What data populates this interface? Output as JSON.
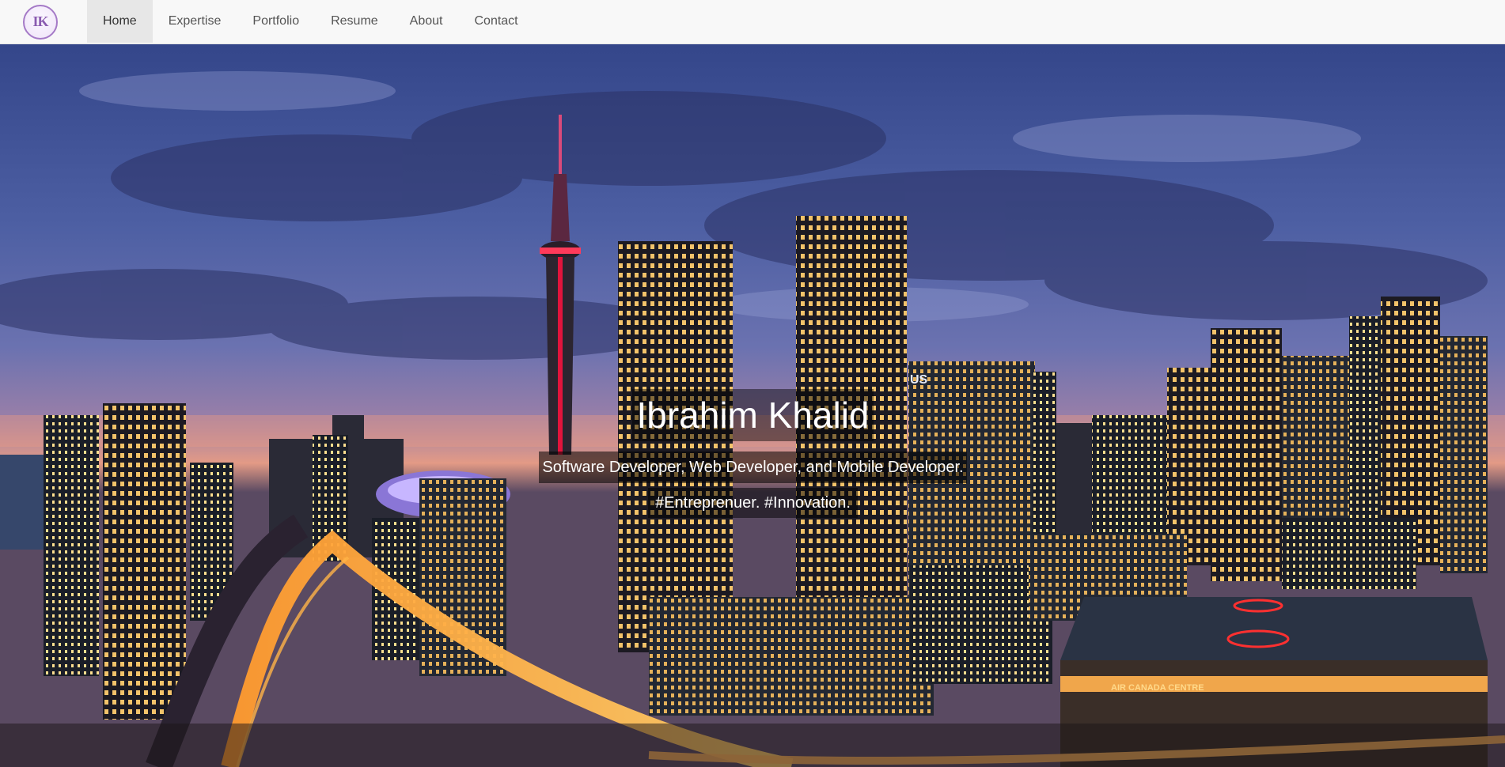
{
  "navbar": {
    "logo_text": "IK",
    "items": [
      {
        "label": "Home",
        "active": true
      },
      {
        "label": "Expertise",
        "active": false
      },
      {
        "label": "Portfolio",
        "active": false
      },
      {
        "label": "Resume",
        "active": false
      },
      {
        "label": "About",
        "active": false
      },
      {
        "label": "Contact",
        "active": false
      }
    ]
  },
  "hero": {
    "title": "Ibrahim Khalid",
    "subtitle": "Software Developer, Web Developer, and Mobile Developer.",
    "tagline": "#Entreprenuer. #Innovation.",
    "background_image": "Toronto city skyline at dusk",
    "arena_sign": "AIR CANADA CENTRE",
    "tower_sign": "US"
  },
  "colors": {
    "nav_bg": "#f8f8f8",
    "nav_active_bg": "#e7e7e7",
    "logo_accent": "#a57ac7"
  }
}
